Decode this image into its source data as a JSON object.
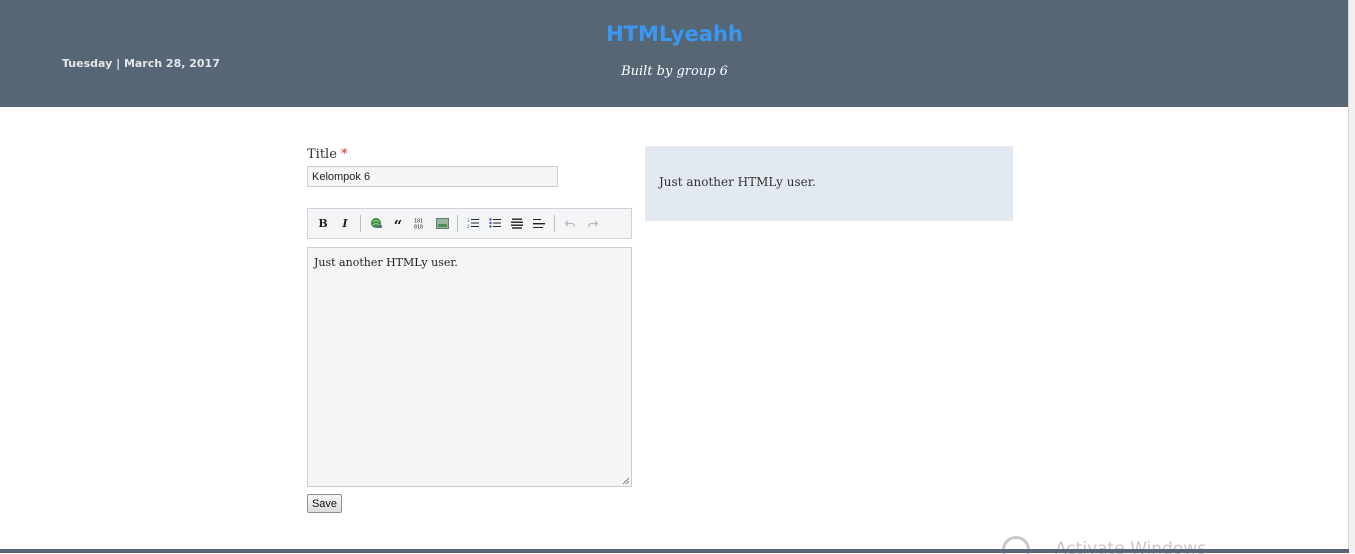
{
  "header": {
    "date": "Tuesday | March 28, 2017",
    "site_title": "HTMLyeahh",
    "tagline": "Built by group 6"
  },
  "form": {
    "title_label": "Title",
    "required_marker": "*",
    "title_value": "Kelompok 6",
    "editor_content": "Just another HTMLy user.",
    "save_label": "Save"
  },
  "toolbar": {
    "buttons": [
      {
        "name": "bold",
        "glyph": "B"
      },
      {
        "name": "italic",
        "glyph": "I"
      },
      {
        "name": "link",
        "icon": "link-icon"
      },
      {
        "name": "quote",
        "glyph": "“"
      },
      {
        "name": "code",
        "icon": "code-icon"
      },
      {
        "name": "image",
        "icon": "image-icon"
      },
      {
        "name": "numbered-list",
        "icon": "numbered-list-icon"
      },
      {
        "name": "bulleted-list",
        "icon": "bulleted-list-icon"
      },
      {
        "name": "heading",
        "icon": "heading-icon"
      },
      {
        "name": "horizontal-rule",
        "icon": "horizontal-rule-icon"
      },
      {
        "name": "undo",
        "icon": "undo-icon"
      },
      {
        "name": "redo",
        "icon": "redo-icon"
      }
    ]
  },
  "preview": {
    "text": "Just another HTMLy user."
  },
  "watermark": {
    "text": "Activate Windows"
  },
  "colors": {
    "header_bg": "#566675",
    "site_title": "#3a97f2",
    "preview_bg": "#e3e9f0",
    "required": "#d9332f"
  }
}
